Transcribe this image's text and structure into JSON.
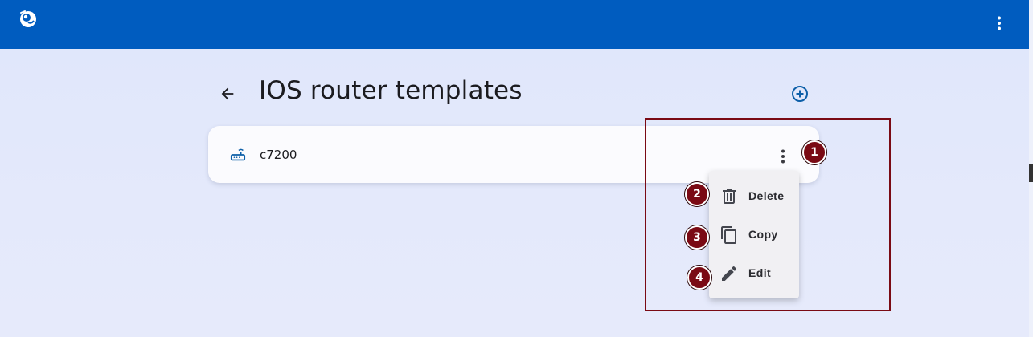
{
  "header": {
    "logo_icon": "gns3-chameleon-logo",
    "menu_icon": "more-vert-icon"
  },
  "page": {
    "title": "IOS router templates",
    "back_icon": "arrow-back-icon",
    "add_icon": "add-circle-icon"
  },
  "templates": [
    {
      "name": "c7200",
      "icon": "router-icon"
    }
  ],
  "context_menu": {
    "items": [
      {
        "label": "Delete",
        "icon": "trash-icon"
      },
      {
        "label": "Copy",
        "icon": "copy-icon"
      },
      {
        "label": "Edit",
        "icon": "pencil-icon"
      }
    ]
  },
  "annotations": {
    "badges": [
      "1",
      "2",
      "3",
      "4"
    ],
    "color": "#7a0a14"
  },
  "colors": {
    "topbar": "#005cbf",
    "accent": "#0d5fa8",
    "background": "#e2e8fb"
  }
}
